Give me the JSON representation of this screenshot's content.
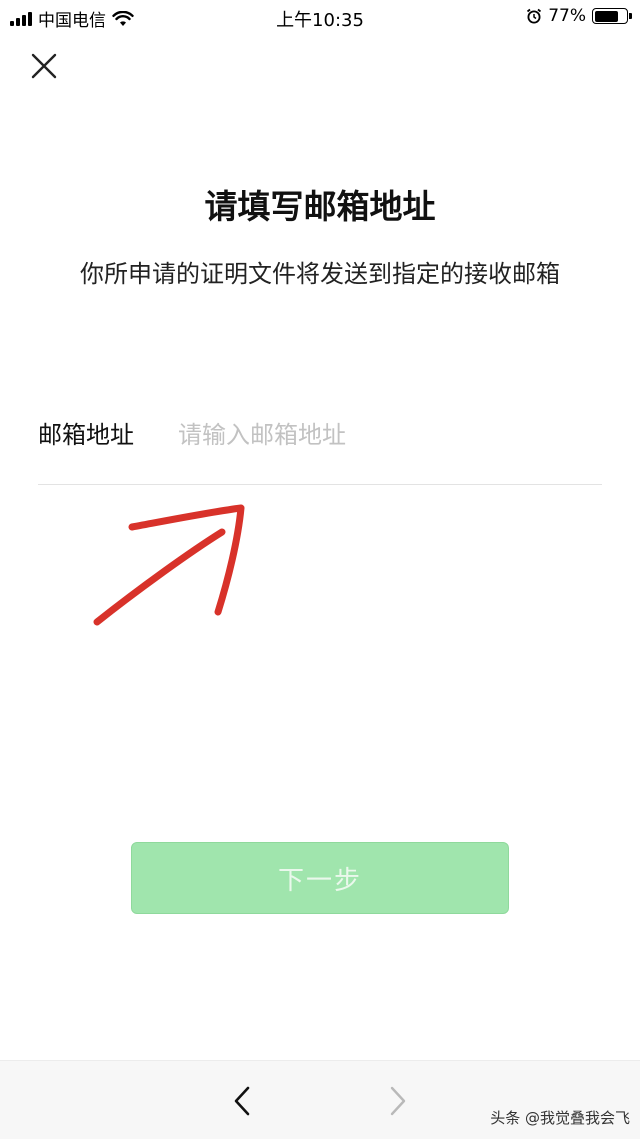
{
  "status_bar": {
    "carrier": "中国电信",
    "time": "上午10:35",
    "battery_percent": "77%",
    "battery_level": 0.77,
    "icons": [
      "signal-icon",
      "wifi-icon",
      "alarm-icon",
      "battery-icon"
    ]
  },
  "header": {
    "close_icon": "close-icon"
  },
  "main": {
    "title": "请填写邮箱地址",
    "subtitle": "你所申请的证明文件将发送到指定的接收邮箱",
    "email": {
      "label": "邮箱地址",
      "placeholder": "请输入邮箱地址",
      "value": ""
    },
    "next_button_label": "下一步"
  },
  "bottom_nav": {
    "back_icon": "chevron-left-icon",
    "forward_icon": "chevron-right-icon"
  },
  "watermark": "头条 @我觉叠我会飞",
  "colors": {
    "button_bg": "#a0e5ad",
    "button_text": "#eaf8ec",
    "annotation": "#d8322a",
    "placeholder": "#c2c2c2"
  }
}
